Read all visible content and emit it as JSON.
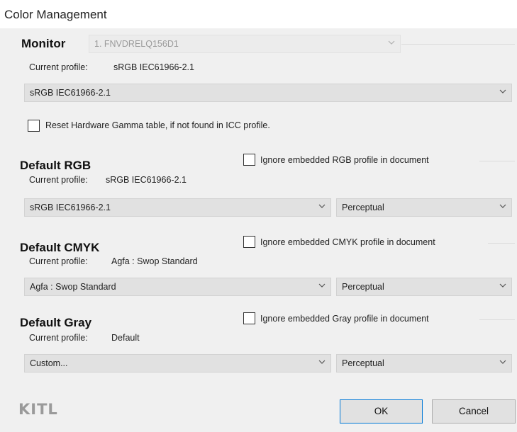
{
  "window": {
    "title": "Color Management"
  },
  "monitor": {
    "heading": "Monitor",
    "selector_value": "1. FNVDRELQ156D1",
    "current_profile_label": "Current profile:",
    "current_profile_value": "sRGB IEC61966-2.1",
    "profile_select_value": "sRGB IEC61966-2.1",
    "reset_gamma_label": "Reset Hardware Gamma table, if not found in ICC profile.",
    "reset_gamma_checked": false
  },
  "default_rgb": {
    "heading": "Default RGB",
    "ignore_label": "Ignore embedded RGB profile in document",
    "ignore_checked": false,
    "current_profile_label": "Current profile:",
    "current_profile_value": "sRGB IEC61966-2.1",
    "profile_select_value": "sRGB IEC61966-2.1",
    "intent_select_value": "Perceptual"
  },
  "default_cmyk": {
    "heading": "Default CMYK",
    "ignore_label": "Ignore embedded CMYK profile in document",
    "ignore_checked": false,
    "current_profile_label": "Current profile:",
    "current_profile_value": "Agfa : Swop Standard",
    "profile_select_value": "Agfa : Swop Standard",
    "intent_select_value": "Perceptual"
  },
  "default_gray": {
    "heading": "Default Gray",
    "ignore_label": "Ignore embedded Gray profile in document",
    "ignore_checked": false,
    "current_profile_label": "Current profile:",
    "current_profile_value": "Default",
    "profile_select_value": "Custom...",
    "intent_select_value": "Perceptual"
  },
  "footer": {
    "logo_text": "KITL",
    "ok_label": "OK",
    "cancel_label": "Cancel"
  },
  "icons": {
    "dropdown": "chevron-down-icon"
  },
  "colors": {
    "accent": "#0078d7",
    "dialog_bg": "#f0f0f0",
    "combo_bg": "#e1e1e1"
  }
}
